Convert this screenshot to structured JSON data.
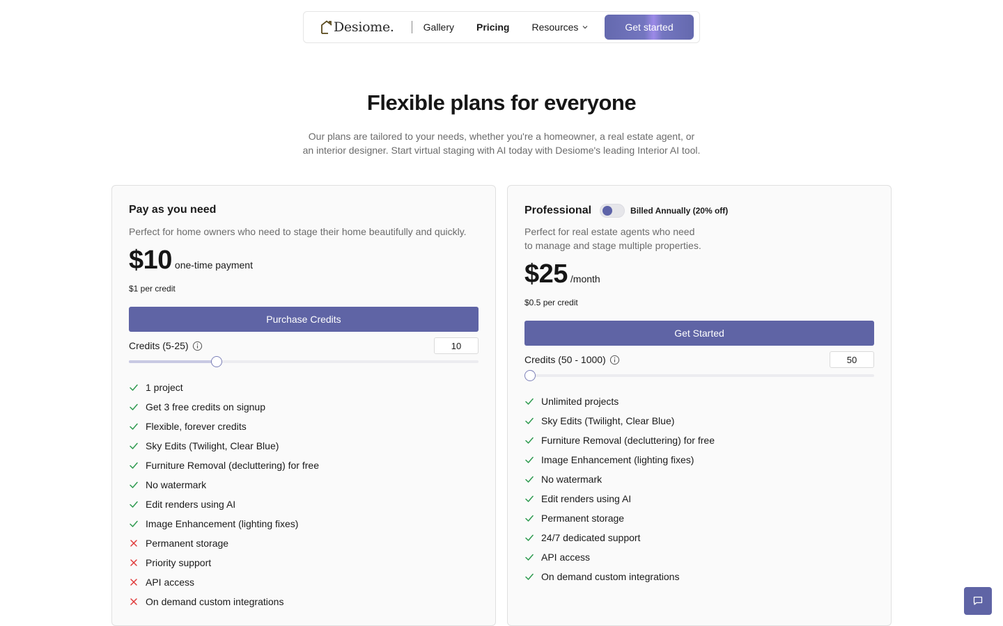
{
  "nav": {
    "logo_text": "Desiome.",
    "links": [
      {
        "label": "Gallery"
      },
      {
        "label": "Pricing"
      },
      {
        "label": "Resources"
      }
    ],
    "cta_label": "Get started"
  },
  "hero": {
    "title": "Flexible plans for everyone",
    "subtitle_line1": "Our plans are tailored to your needs, whether you're a homeowner, a real estate agent, or",
    "subtitle_line2": "an interior designer. Start virtual staging with AI today with Desiome's leading Interior AI tool."
  },
  "plans": [
    {
      "name": "Pay as you need",
      "description": "Perfect for home owners who need to stage their home beautifully and quickly.",
      "price": "$10",
      "price_note": "one-time payment",
      "per_credit": "$1 per credit",
      "cta_label": "Purchase Credits",
      "credits_label": "Credits (5-25)",
      "credits_value": "10",
      "credits_min": 5,
      "credits_max": 25,
      "features": [
        {
          "label": "1 project",
          "included": true
        },
        {
          "label": "Get 3 free credits on signup",
          "included": true
        },
        {
          "label": "Flexible, forever credits",
          "included": true
        },
        {
          "label": "Sky Edits (Twilight, Clear Blue)",
          "included": true
        },
        {
          "label": "Furniture Removal (decluttering) for free",
          "included": true
        },
        {
          "label": "No watermark",
          "included": true
        },
        {
          "label": "Edit renders using AI",
          "included": true
        },
        {
          "label": "Image Enhancement (lighting fixes)",
          "included": true
        },
        {
          "label": "Permanent storage",
          "included": false
        },
        {
          "label": "Priority support",
          "included": false
        },
        {
          "label": "API access",
          "included": false
        },
        {
          "label": "On demand custom integrations",
          "included": false
        }
      ]
    },
    {
      "name": "Professional",
      "billing_toggle_label": "Billed Annually (20% off)",
      "billing_toggle_on": false,
      "description_line1": "Perfect for real estate agents who need",
      "description_line2": "to manage and stage multiple properties.",
      "price": "$25",
      "price_note": "/month",
      "per_credit": "$0.5 per credit",
      "cta_label": "Get Started",
      "credits_label": "Credits (50 - 1000)",
      "credits_value": "50",
      "credits_min": 50,
      "credits_max": 1000,
      "features": [
        {
          "label": "Unlimited projects",
          "included": true
        },
        {
          "label": "Sky Edits (Twilight, Clear Blue)",
          "included": true
        },
        {
          "label": "Furniture Removal (decluttering) for free",
          "included": true
        },
        {
          "label": "Image Enhancement (lighting fixes)",
          "included": true
        },
        {
          "label": "No watermark",
          "included": true
        },
        {
          "label": "Edit renders using AI",
          "included": true
        },
        {
          "label": "Permanent storage",
          "included": true
        },
        {
          "label": "24/7 dedicated support",
          "included": true
        },
        {
          "label": "API access",
          "included": true
        },
        {
          "label": "On demand custom integrations",
          "included": true
        }
      ]
    }
  ],
  "colors": {
    "accent": "#5f64a5",
    "check": "#2e9a4f",
    "cross": "#e03a3a"
  },
  "icons": {
    "logo": "house-outline-icon",
    "resources_chevron": "chevron-down-icon",
    "credits_info": "info-icon",
    "included": "check-icon",
    "excluded": "x-icon",
    "chat": "chat-icon"
  }
}
